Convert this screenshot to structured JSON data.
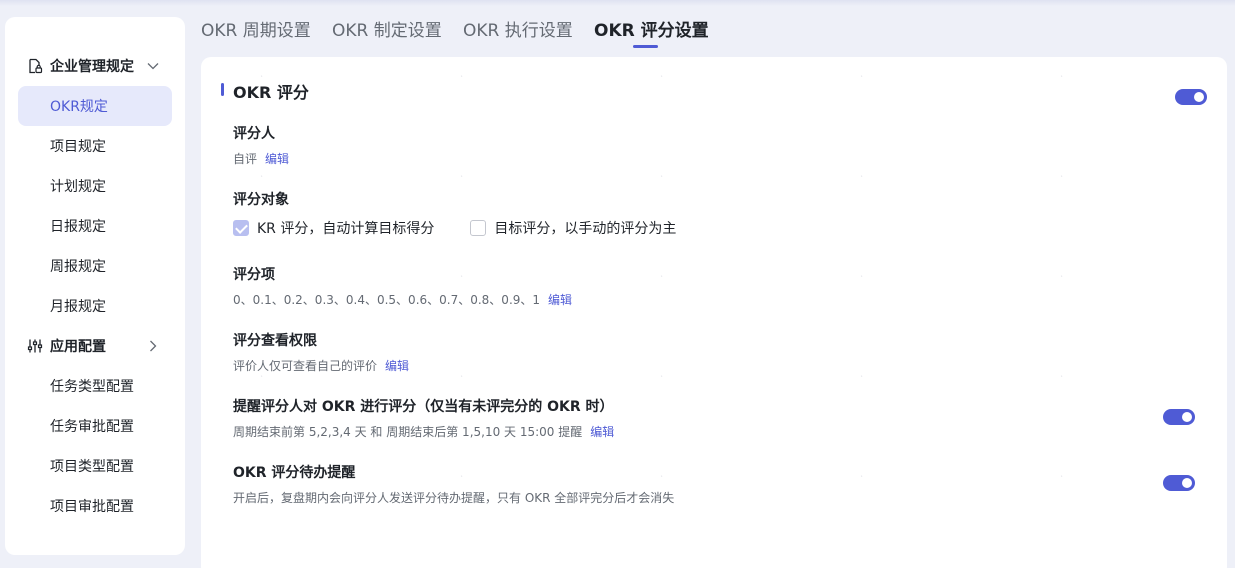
{
  "sidebar": {
    "group1": {
      "label": "企业管理规定",
      "icon": "document-lock-icon",
      "expanded": true
    },
    "group1_items": [
      "OKR规定",
      "项目规定",
      "计划规定",
      "日报规定",
      "周报规定",
      "月报规定"
    ],
    "group2": {
      "label": "应用配置",
      "icon": "sliders-icon",
      "expanded": false
    },
    "group2_items": [
      "任务类型配置",
      "任务审批配置",
      "项目类型配置",
      "项目审批配置"
    ],
    "active_item": "OKR规定"
  },
  "tabs": {
    "items": [
      "OKR 周期设置",
      "OKR 制定设置",
      "OKR 执行设置",
      "OKR 评分设置"
    ],
    "active": "OKR 评分设置"
  },
  "card": {
    "title": "OKR 评分",
    "main_toggle_on": true,
    "raters": {
      "title": "评分人",
      "value": "自评",
      "edit": "编辑"
    },
    "target": {
      "title": "评分对象",
      "option1": {
        "label": "KR 评分，自动计算目标得分",
        "checked": true
      },
      "option2": {
        "label": "目标评分，以手动的评分为主",
        "checked": false
      }
    },
    "items": {
      "title": "评分项",
      "value": "0、0.1、0.2、0.3、0.4、0.5、0.6、0.7、0.8、0.9、1",
      "edit": "编辑"
    },
    "view": {
      "title": "评分查看权限",
      "value": "评价人仅可查看自己的评价",
      "edit": "编辑"
    },
    "remind": {
      "title": "提醒评分人对 OKR 进行评分（仅当有未评完分的 OKR 时）",
      "value": "周期结束前第 5,2,3,4 天 和 周期结束后第 1,5,10 天 15:00 提醒",
      "edit": "编辑",
      "toggle_on": true
    },
    "todo": {
      "title": "OKR 评分待办提醒",
      "value": "开启后，复盘期内会向评分人发送评分待办提醒，只有 OKR 全部评完分后才会消失",
      "toggle_on": true
    }
  },
  "colors": {
    "accent": "#4f5bd5",
    "active_bg": "#e6e9fb",
    "page_bg": "#eef0f8"
  }
}
